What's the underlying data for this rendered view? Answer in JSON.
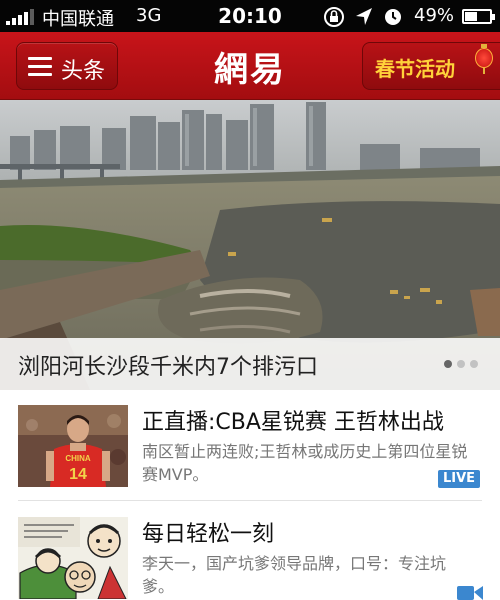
{
  "status_bar": {
    "carrier": "中国联通",
    "network": "3G",
    "time": "20:10",
    "battery_percent": "49%",
    "battery_level": 0.49
  },
  "nav": {
    "menu_label": "头条",
    "logo_text": "網易",
    "event_label": "春节活动"
  },
  "hero": {
    "caption": "浏阳河长沙段千米内7个排污口",
    "page_count": 3,
    "active_page": 1
  },
  "news": [
    {
      "title": "正直播:CBA星锐赛 王哲林出战",
      "description": "南区暂止两连败;王哲林或成历史上第四位星锐赛MVP。",
      "badge": "LIVE",
      "jersey_text": "CHINA",
      "jersey_number": "14"
    },
    {
      "title": "每日轻松一刻",
      "description": "李天一，国产坑爹领导品牌，口号：专注坑爹。",
      "badge_icon": "video-icon"
    }
  ],
  "colors": {
    "nav_red": "#b8111a",
    "event_gold": "#ffd23a",
    "live_blue": "#3b87cf"
  }
}
